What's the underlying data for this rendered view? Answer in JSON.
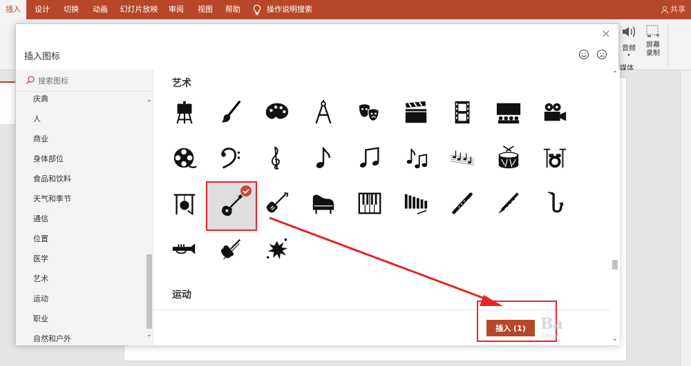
{
  "ribbon": {
    "tabs": [
      {
        "label": "插入",
        "active": true
      },
      {
        "label": "设计"
      },
      {
        "label": "切换"
      },
      {
        "label": "动画"
      },
      {
        "label": "幻灯片放映"
      },
      {
        "label": "审阅"
      },
      {
        "label": "视图"
      },
      {
        "label": "帮助"
      },
      {
        "label": "操作说明搜索"
      }
    ],
    "share_label": "共享",
    "audio_label": "音频",
    "screen_record_label_1": "屏幕",
    "screen_record_label_2": "录制",
    "media_group_label": "媒体"
  },
  "dialog": {
    "title": "插入图标",
    "search_placeholder": "搜索图标",
    "categories": [
      "庆典",
      "人",
      "商业",
      "身体部位",
      "食品和饮料",
      "天气和季节",
      "通信",
      "位置",
      "医学",
      "艺术",
      "运动",
      "职业",
      "自然和户外"
    ],
    "section_art": "艺术",
    "section_sport": "运动",
    "insert_button": "插入 (1)",
    "selected_icon": "guitar-icon",
    "icons": [
      "easel-icon",
      "paintbrush-icon",
      "palette-icon",
      "compass-icon",
      "theater-masks-icon",
      "clapperboard-icon",
      "film-strip-icon",
      "theater-stage-icon",
      "movie-camera-icon",
      "film-reel-icon",
      "bass-clef-icon",
      "treble-clef-icon",
      "eighth-note-icon",
      "beamed-notes-icon",
      "music-notes-icon",
      "sheet-music-icon",
      "drum-icon",
      "drum-kit-icon",
      "gong-icon",
      "guitar-icon",
      "electric-guitar-icon",
      "grand-piano-icon",
      "piano-keys-icon",
      "xylophone-icon",
      "flute-icon",
      "clarinet-icon",
      "saxophone-icon",
      "trumpet-icon",
      "violin-icon",
      "paint-splatter-icon"
    ]
  },
  "colors": {
    "accent": "#b7472a",
    "annotation": "#e8231f"
  }
}
